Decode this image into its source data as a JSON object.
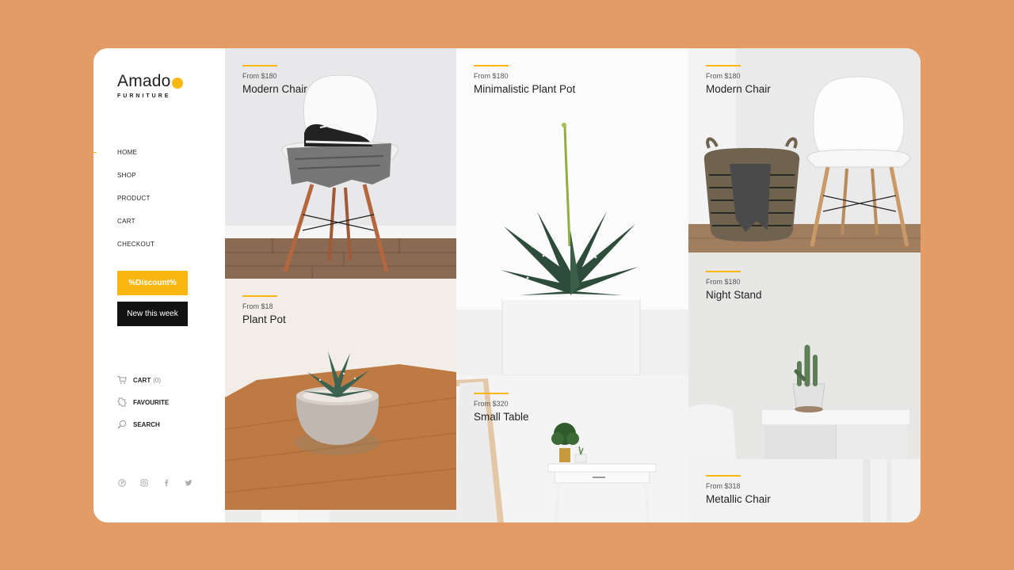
{
  "brand": {
    "name": "Amado",
    "subtitle": "FURNITURE",
    "accent": "#fbb710"
  },
  "nav": {
    "items": [
      "HOME",
      "SHOP",
      "PRODUCT",
      "CART",
      "CHECKOUT"
    ],
    "active": "HOME"
  },
  "buttons": {
    "discount": "%Discount%",
    "new_week": "New this week"
  },
  "utility": {
    "cart_label": "CART",
    "cart_count": "(0)",
    "favourite_label": "FAVOURITE",
    "search_label": "SEARCH"
  },
  "social": [
    "pinterest-icon",
    "instagram-icon",
    "facebook-icon",
    "twitter-icon"
  ],
  "products": [
    {
      "price": "From $180",
      "name": "Modern Chair"
    },
    {
      "price": "From $180",
      "name": "Minimalistic Plant Pot"
    },
    {
      "price": "From $180",
      "name": "Modern Chair"
    },
    {
      "price": "From $18",
      "name": "Plant Pot"
    },
    {
      "price": "From $320",
      "name": "Small Table"
    },
    {
      "price": "From $180",
      "name": "Night Stand"
    },
    {
      "price": "From $318",
      "name": "Metallic Chair"
    }
  ]
}
